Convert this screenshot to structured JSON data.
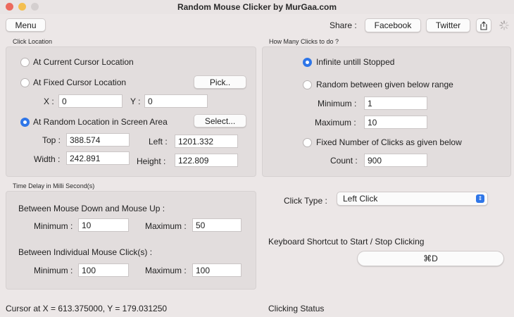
{
  "window": {
    "title": "Random Mouse Clicker by MurGaa.com",
    "traffic_lights": {
      "close": "#ec6a5e",
      "minimize": "#f4bf4f",
      "zoom": "#d4cfcf"
    }
  },
  "toolbar": {
    "menu_label": "Menu",
    "share_label": "Share :",
    "facebook_label": "Facebook",
    "twitter_label": "Twitter",
    "share_icon": "share-icon",
    "spinner_icon": "spinner-icon"
  },
  "click_location": {
    "section_label": "Click Location",
    "options": {
      "current": "At Current Cursor Location",
      "fixed": "At Fixed Cursor Location",
      "random": "At Random Location in Screen Area"
    },
    "selected": "random",
    "pick_label": "Pick..",
    "select_label": "Select...",
    "x_label": "X :",
    "x_value": "0",
    "y_label": "Y :",
    "y_value": "0",
    "top_label": "Top :",
    "top_value": "388.574",
    "left_label": "Left :",
    "left_value": "1201.332",
    "width_label": "Width :",
    "width_value": "242.891",
    "height_label": "Height :",
    "height_value": "122.809"
  },
  "clicks_count": {
    "section_label": "How Many Clicks to do ?",
    "options": {
      "infinite": "Infinite untill Stopped",
      "random": "Random between given below range",
      "fixed": "Fixed Number of Clicks as given below"
    },
    "selected": "infinite",
    "min_label": "Minimum :",
    "min_value": "1",
    "max_label": "Maximum :",
    "max_value": "10",
    "count_label": "Count :",
    "count_value": "900"
  },
  "time_delay": {
    "section_label": "Time Delay in Milli Second(s)",
    "down_up_label": "Between Mouse Down and Mouse Up :",
    "down_up_min_label": "Minimum :",
    "down_up_min_value": "10",
    "down_up_max_label": "Maximum :",
    "down_up_max_value": "50",
    "between_label": "Between Individual Mouse Click(s) :",
    "between_min_label": "Minimum :",
    "between_min_value": "100",
    "between_max_label": "Maximum :",
    "between_max_value": "100"
  },
  "click_type": {
    "label": "Click Type :",
    "value": "Left Click"
  },
  "shortcut": {
    "label": "Keyboard Shortcut to Start / Stop Clicking",
    "value": "⌘D"
  },
  "status": {
    "cursor_text": "Cursor at X = 613.375000, Y = 179.031250",
    "clicking_status_label": "Clicking Status"
  },
  "accent_color": "#2f76e8"
}
